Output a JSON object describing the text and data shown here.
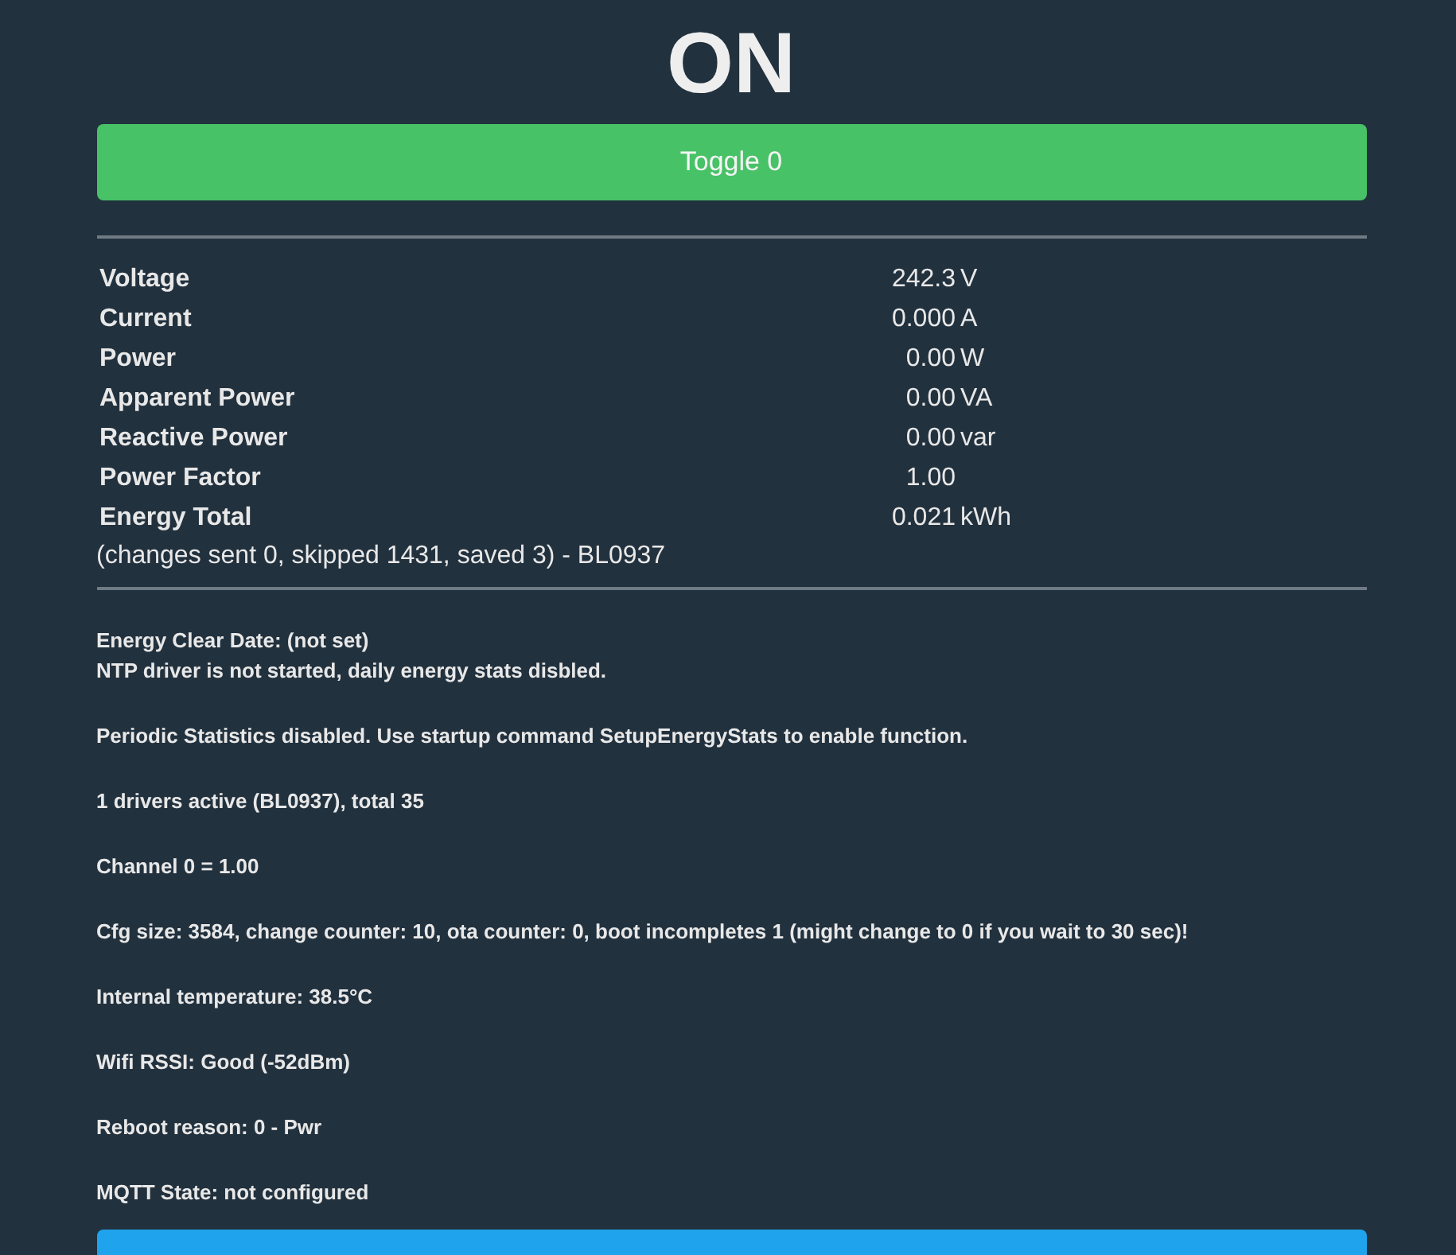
{
  "state": "ON",
  "toggle_button": {
    "label": "Toggle 0",
    "on": true
  },
  "measurements": [
    {
      "label": "Voltage",
      "value": "242.3",
      "unit": "V"
    },
    {
      "label": "Current",
      "value": "0.000",
      "unit": "A"
    },
    {
      "label": "Power",
      "value": "0.00",
      "unit": "W"
    },
    {
      "label": "Apparent Power",
      "value": "0.00",
      "unit": "VA"
    },
    {
      "label": "Reactive Power",
      "value": "0.00",
      "unit": "var"
    },
    {
      "label": "Power Factor",
      "value": "1.00"
    },
    {
      "label": "Energy Total",
      "value": "0.021",
      "unit": "kWh"
    }
  ],
  "measurement_note": "(changes sent 0, skipped 1431, saved 3) - BL0937",
  "info_paragraphs": [
    [
      "Energy Clear Date: (not set)",
      "NTP driver is not started, daily energy stats disbled."
    ],
    [
      "Periodic Statistics disabled. Use startup command SetupEnergyStats to enable function."
    ],
    [
      "1 drivers active (BL0937), total 35"
    ],
    [
      "Channel 0 = 1.00"
    ],
    [
      "Cfg size: 3584, change counter: 10, ota counter: 0, boot incompletes 1 (might change to 0 if you wait to 30 sec)!"
    ],
    [
      "Internal temperature: 38.5°C"
    ],
    [
      "Wifi RSSI: Good (-52dBm)"
    ],
    [
      "Reboot reason: 0 - Pwr"
    ],
    [
      "MQTT State: not configured"
    ]
  ]
}
